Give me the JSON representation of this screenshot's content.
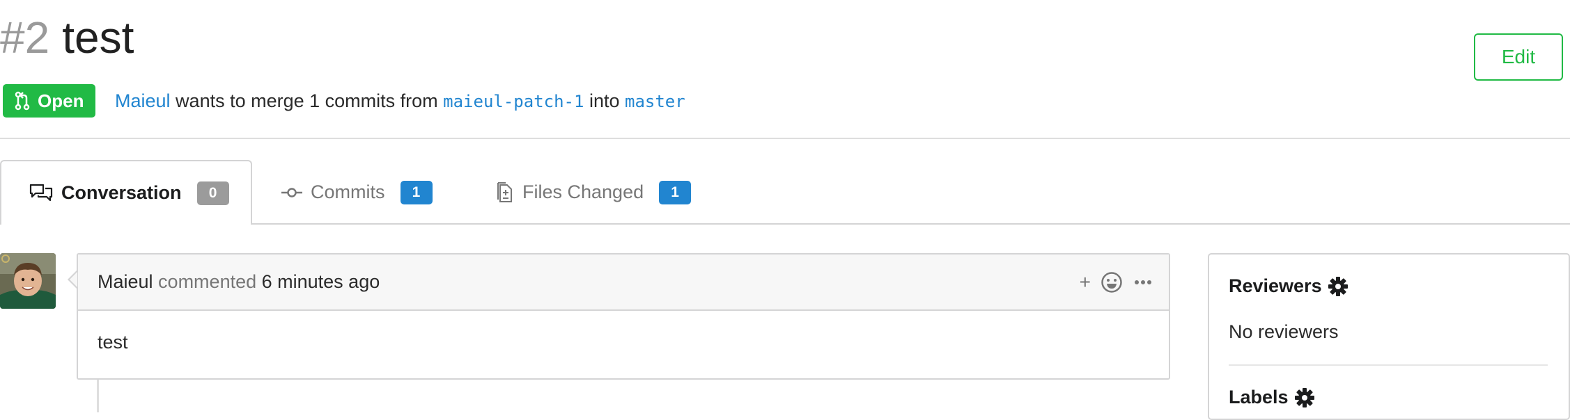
{
  "pr": {
    "number": "#2",
    "title": "test",
    "status": "Open",
    "author": "Maieul",
    "merge_text_1": " wants to merge 1 commits from ",
    "source_branch": "maieul-patch-1",
    "merge_text_2": " into ",
    "target_branch": "master",
    "edit_label": "Edit"
  },
  "tabs": [
    {
      "label": "Conversation",
      "count": "0",
      "active": true,
      "icon": "comments-icon"
    },
    {
      "label": "Commits",
      "count": "1",
      "active": false,
      "icon": "commit-icon"
    },
    {
      "label": "Files Changed",
      "count": "1",
      "active": false,
      "icon": "file-diff-icon"
    }
  ],
  "comment": {
    "author": "Maieul",
    "verb": " commented ",
    "time": "6 minutes ago",
    "body": "test",
    "add_reaction": "+"
  },
  "sidebar": {
    "reviewers_title": "Reviewers",
    "reviewers_value": "No reviewers",
    "labels_title": "Labels"
  },
  "colors": {
    "green": "#21ba45",
    "blue": "#2185d0",
    "grey_badge": "#9b9b9b",
    "border": "#d4d4d5"
  }
}
